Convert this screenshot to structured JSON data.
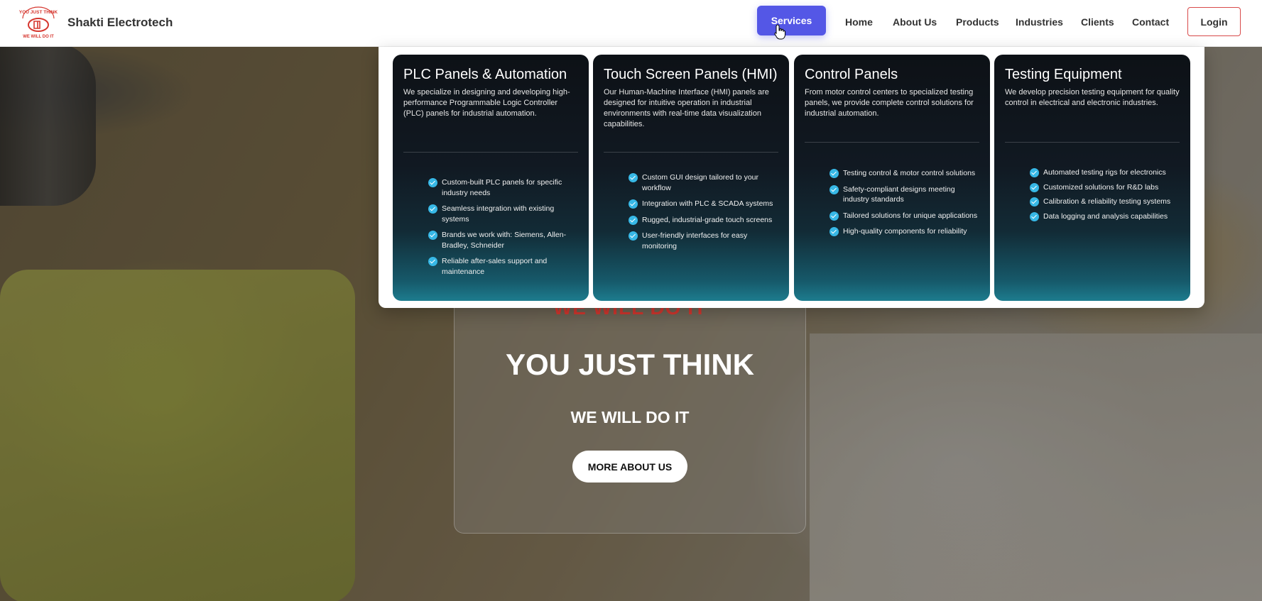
{
  "brand": {
    "name": "Shakti Electrotech",
    "logo_top_text": "YOU JUST THINK",
    "logo_bottom_text": "WE WILL DO IT"
  },
  "nav": {
    "services": "Services",
    "home": "Home",
    "about": "About Us",
    "products": "Products",
    "industries": "Industries",
    "clients": "Clients",
    "contact": "Contact",
    "login": "Login"
  },
  "hero": {
    "tagline": "WE WILL DO IT",
    "title": "YOU JUST THINK",
    "subtitle": "WE WILL DO IT",
    "button": "MORE ABOUT US"
  },
  "services_menu": [
    {
      "title": "PLC Panels & Automation",
      "description": "We specialize in designing and developing high-performance Programmable Logic Controller (PLC) panels for industrial automation.",
      "features": [
        "Custom-built PLC panels for specific industry needs",
        "Seamless integration with existing systems",
        "Brands we work with: Siemens, Allen-Bradley, Schneider",
        "Reliable after-sales support and maintenance"
      ]
    },
    {
      "title": "Touch Screen Panels (HMI)",
      "description": "Our Human-Machine Interface (HMI) panels are designed for intuitive operation in industrial environments with real-time data visualization capabilities.",
      "features": [
        "Custom GUI design tailored to your workflow",
        "Integration with PLC & SCADA systems",
        "Rugged, industrial-grade touch screens",
        "User-friendly interfaces for easy monitoring"
      ]
    },
    {
      "title": "Control Panels",
      "description": "From motor control centers to specialized testing panels, we provide complete control solutions for industrial automation.",
      "features": [
        "Testing control & motor control solutions",
        "Safety-compliant designs meeting industry standards",
        "Tailored solutions for unique applications",
        "High-quality components for reliability"
      ]
    },
    {
      "title": "Testing Equipment",
      "description": "We develop precision testing equipment for quality control in electrical and electronic industries.",
      "features": [
        "Automated testing rigs for electronics",
        "Customized solutions for R&D labs",
        "Calibration & reliability testing systems",
        "Data logging and analysis capabilities"
      ]
    }
  ],
  "colors": {
    "services_button": "#5457e6",
    "login_border": "#d84a4a",
    "check_icon": "#37b8e6",
    "hero_tagline": "#d6372f"
  }
}
